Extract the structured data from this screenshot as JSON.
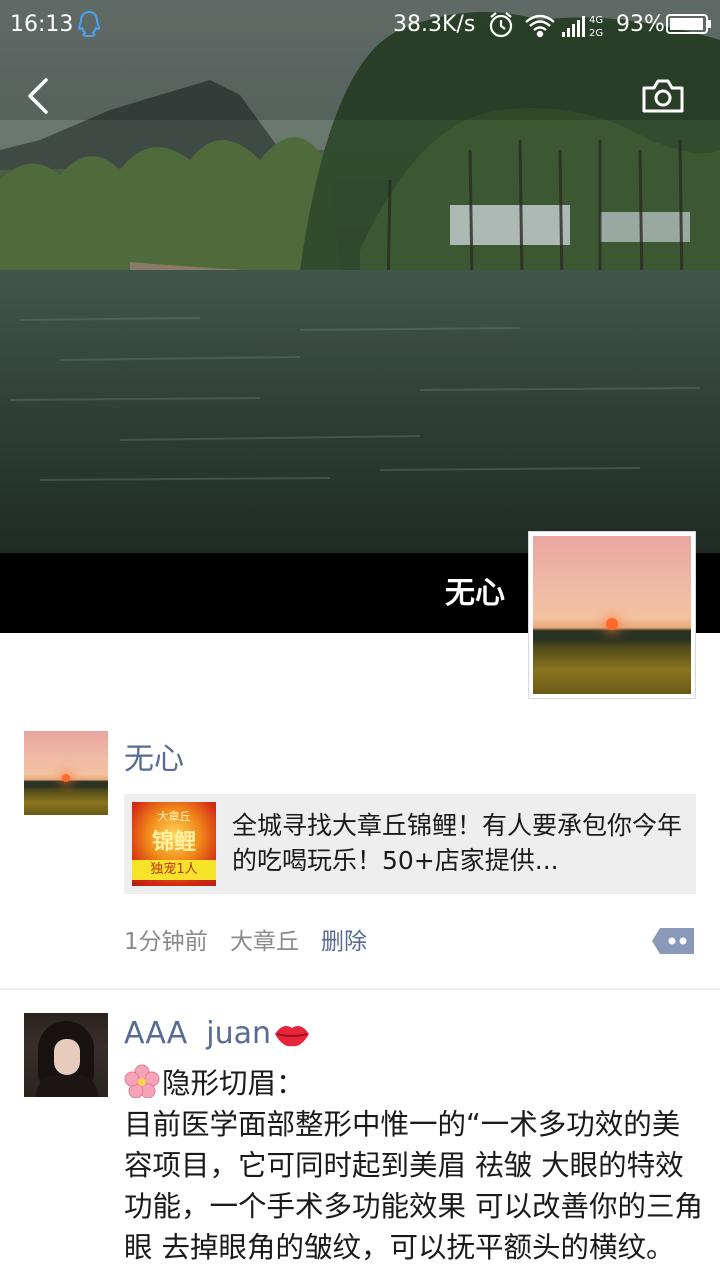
{
  "status_bar": {
    "time": "16:13",
    "net_speed": "38.3K/s",
    "network": "4G 2G",
    "battery": "93%"
  },
  "header": {
    "back_icon": "chevron-left-icon",
    "camera_icon": "camera-icon"
  },
  "profile": {
    "cover_name": "无心"
  },
  "posts": [
    {
      "author": "无心",
      "link": {
        "title": "全城寻找大章丘锦鲤！有人要承包你今年的吃喝玩乐！50+店家提供...",
        "thumb_small": "大章丘",
        "thumb_big": "锦鲤",
        "thumb_bottom": "独宠1人"
      },
      "time": "1分钟前",
      "location": "大章丘",
      "delete_label": "删除",
      "comment_icon": "more-dots-icon"
    },
    {
      "author": "AAA  juan",
      "author_emoji": "lips-icon",
      "body_emoji": "flower-icon",
      "body_heading": "隐形切眉：",
      "body": "目前医学面部整形中惟一的“一术多功效的美容项目，它可同时起到美眉 祛皱 大眼的特效功能，一个手术多功能效果 可以改善你的三角眼 去掉眼角的皱纹，可以抚平额头的横纹。"
    }
  ]
}
